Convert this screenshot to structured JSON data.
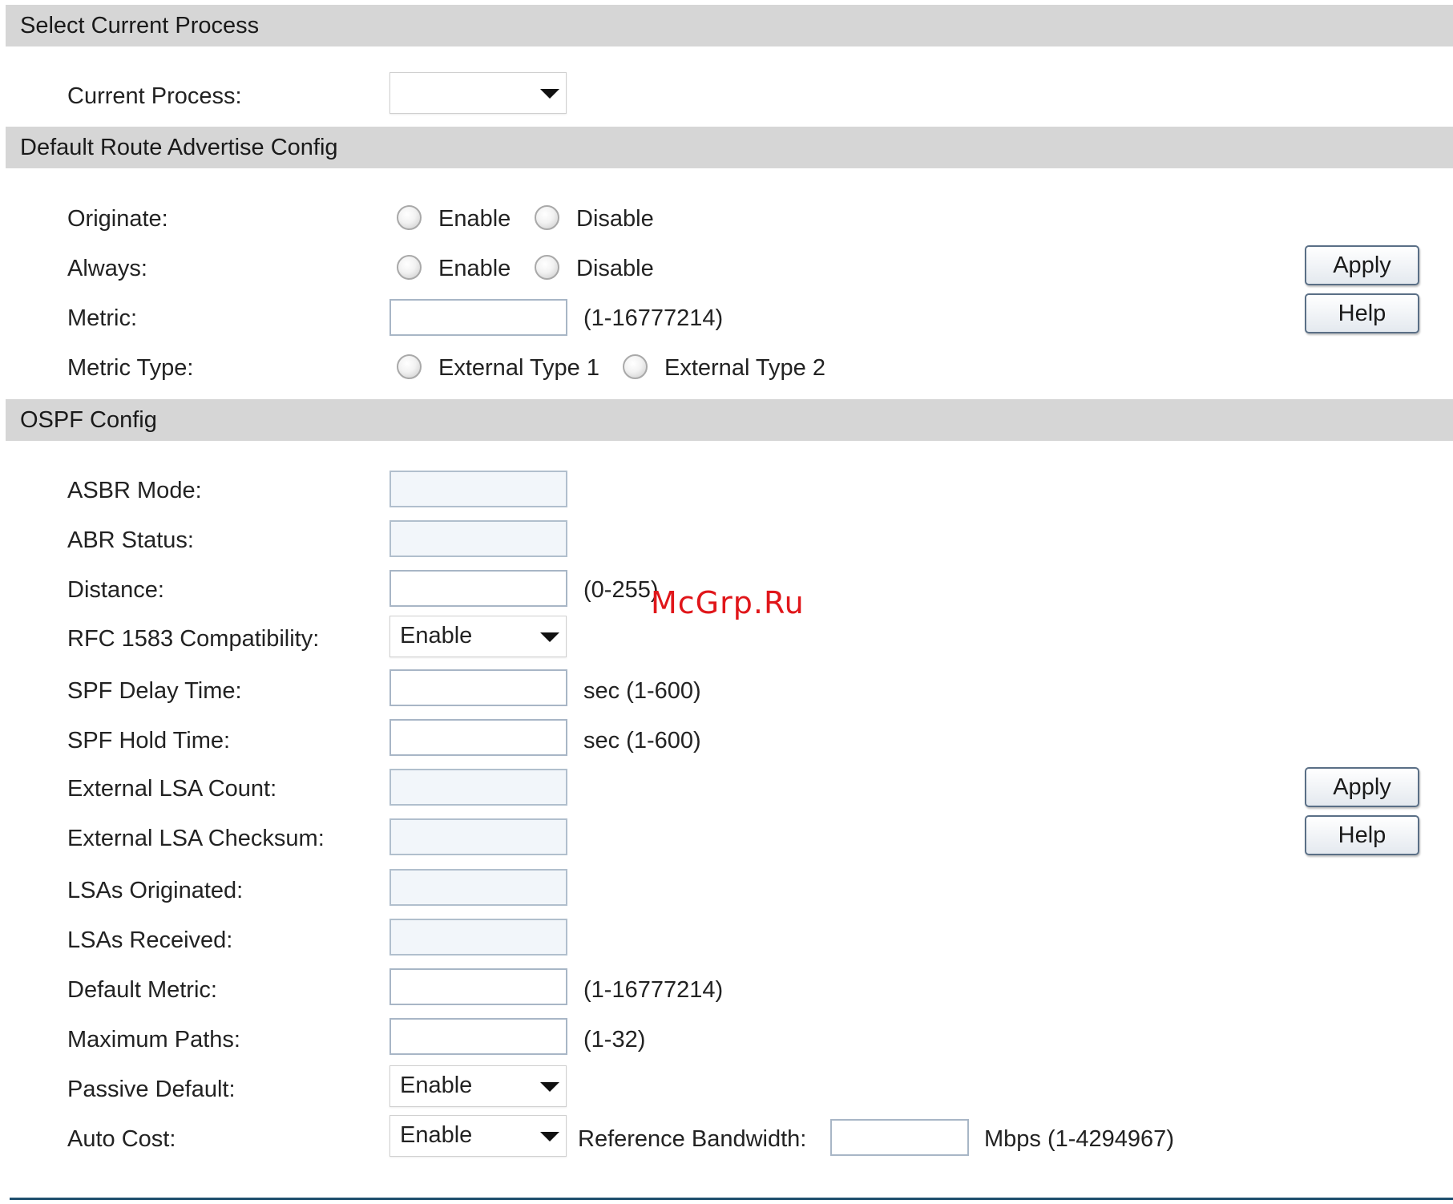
{
  "sections": {
    "select_process": {
      "title": "Select Current Process"
    },
    "default_route": {
      "title": "Default Route Advertise Config"
    },
    "ospf": {
      "title": "OSPF Config"
    }
  },
  "select_process": {
    "current_process_label": "Current Process:",
    "current_process_value": ""
  },
  "default_route": {
    "originate_label": "Originate:",
    "always_label": "Always:",
    "metric_label": "Metric:",
    "metric_range": "(1-16777214)",
    "metric_type_label": "Metric Type:",
    "enable": "Enable",
    "disable": "Disable",
    "external_type_1": "External Type 1",
    "external_type_2": "External Type 2",
    "apply": "Apply",
    "help": "Help"
  },
  "ospf": {
    "asbr_mode_label": "ASBR Mode:",
    "abr_status_label": "ABR Status:",
    "distance_label": "Distance:",
    "distance_range": "(0-255)",
    "rfc1583_label": "RFC 1583 Compatibility:",
    "rfc1583_value": "Enable",
    "spf_delay_label": "SPF Delay Time:",
    "spf_delay_range": "sec (1-600)",
    "spf_hold_label": "SPF Hold Time:",
    "spf_hold_range": "sec (1-600)",
    "ext_lsa_count_label": "External LSA Count:",
    "ext_lsa_checksum_label": "External LSA Checksum:",
    "lsas_originated_label": "LSAs Originated:",
    "lsas_received_label": "LSAs Received:",
    "default_metric_label": "Default Metric:",
    "default_metric_range": "(1-16777214)",
    "max_paths_label": "Maximum Paths:",
    "max_paths_range": "(1-32)",
    "passive_default_label": "Passive Default:",
    "passive_default_value": "Enable",
    "auto_cost_label": "Auto Cost:",
    "auto_cost_value": "Enable",
    "ref_bandwidth_label": "Reference Bandwidth:",
    "ref_bandwidth_range": "Mbps (1-4294967)",
    "apply": "Apply",
    "help": "Help"
  },
  "watermark": "McGrp.Ru"
}
